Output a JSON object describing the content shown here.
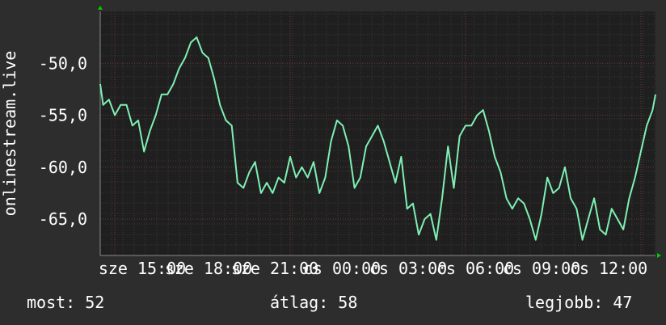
{
  "chart_data": {
    "type": "line",
    "ylabel": "onlinestream.live",
    "ylim": [
      -68.5,
      -45
    ],
    "y_ticks": [
      -65,
      -60,
      -55,
      -50
    ],
    "y_tick_labels": [
      "-65,0",
      "-60,0",
      "-55,0",
      "-50,0"
    ],
    "xlim": [
      14.75,
      24.25
    ],
    "x_ticks": [
      15,
      18,
      21,
      24,
      27,
      30,
      33,
      36
    ],
    "x_tick_labels": [
      "sze 15:00",
      "sze 18:00",
      "sze 21:00",
      "cs 00:00",
      "cs 03:00",
      "cs 06:00",
      "cs 09:00",
      "cs 12:00"
    ],
    "grid": true,
    "colors": {
      "line": "#7ff0b4",
      "background": "#1f1f1f",
      "grid": "#6e3838",
      "axis_arrow": "#00cc00"
    },
    "series": [
      {
        "values": [
          [
            14.75,
            -52.0
          ],
          [
            14.8,
            -54.0
          ],
          [
            14.9,
            -53.5
          ],
          [
            15.0,
            -55.0
          ],
          [
            15.1,
            -54.0
          ],
          [
            15.2,
            -54.0
          ],
          [
            15.3,
            -56.0
          ],
          [
            15.4,
            -55.5
          ],
          [
            15.5,
            -58.5
          ],
          [
            15.6,
            -56.5
          ],
          [
            15.7,
            -55.0
          ],
          [
            15.8,
            -53.0
          ],
          [
            15.9,
            -53.0
          ],
          [
            16.0,
            -52.0
          ],
          [
            16.1,
            -50.5
          ],
          [
            16.2,
            -49.5
          ],
          [
            16.3,
            -48.0
          ],
          [
            16.4,
            -47.5
          ],
          [
            16.5,
            -49.0
          ],
          [
            16.6,
            -49.5
          ],
          [
            16.7,
            -51.5
          ],
          [
            16.8,
            -54.0
          ],
          [
            16.9,
            -55.5
          ],
          [
            17.0,
            -56.0
          ],
          [
            17.1,
            -61.5
          ],
          [
            17.2,
            -62.0
          ],
          [
            17.3,
            -60.5
          ],
          [
            17.4,
            -59.5
          ],
          [
            17.5,
            -62.5
          ],
          [
            17.6,
            -61.5
          ],
          [
            17.7,
            -62.5
          ],
          [
            17.8,
            -61.0
          ],
          [
            17.9,
            -61.5
          ],
          [
            18.0,
            -59.0
          ],
          [
            18.1,
            -61.0
          ],
          [
            18.2,
            -60.0
          ],
          [
            18.3,
            -61.0
          ],
          [
            18.4,
            -59.5
          ],
          [
            18.5,
            -62.5
          ],
          [
            18.6,
            -61.0
          ],
          [
            18.7,
            -57.5
          ],
          [
            18.8,
            -55.5
          ],
          [
            18.9,
            -56.0
          ],
          [
            19.0,
            -58.0
          ],
          [
            19.1,
            -62.0
          ],
          [
            19.2,
            -61.0
          ],
          [
            19.3,
            -58.0
          ],
          [
            19.4,
            -57.0
          ],
          [
            19.5,
            -56.0
          ],
          [
            19.6,
            -57.5
          ],
          [
            19.7,
            -59.5
          ],
          [
            19.8,
            -61.5
          ],
          [
            19.9,
            -59.0
          ],
          [
            20.0,
            -64.0
          ],
          [
            20.1,
            -63.5
          ],
          [
            20.2,
            -66.5
          ],
          [
            20.3,
            -65.0
          ],
          [
            20.4,
            -64.5
          ],
          [
            20.5,
            -67.0
          ],
          [
            20.6,
            -63.0
          ],
          [
            20.7,
            -58.0
          ],
          [
            20.8,
            -62.0
          ],
          [
            20.9,
            -57.0
          ],
          [
            21.0,
            -56.0
          ],
          [
            21.1,
            -56.0
          ],
          [
            21.2,
            -55.0
          ],
          [
            21.3,
            -54.5
          ],
          [
            21.4,
            -56.5
          ],
          [
            21.5,
            -59.0
          ],
          [
            21.6,
            -60.5
          ],
          [
            21.7,
            -63.0
          ],
          [
            21.8,
            -64.0
          ],
          [
            21.9,
            -63.0
          ],
          [
            22.0,
            -63.5
          ],
          [
            22.1,
            -65.0
          ],
          [
            22.2,
            -67.0
          ],
          [
            22.3,
            -64.5
          ],
          [
            22.4,
            -61.0
          ],
          [
            22.5,
            -62.5
          ],
          [
            22.6,
            -62.0
          ],
          [
            22.7,
            -60.0
          ],
          [
            22.8,
            -63.0
          ],
          [
            22.9,
            -64.0
          ],
          [
            23.0,
            -67.0
          ],
          [
            23.1,
            -65.0
          ],
          [
            23.2,
            -63.0
          ],
          [
            23.3,
            -66.0
          ],
          [
            23.4,
            -66.5
          ],
          [
            23.5,
            -64.0
          ],
          [
            23.6,
            -65.0
          ],
          [
            23.7,
            -66.0
          ],
          [
            23.8,
            -63.0
          ],
          [
            23.9,
            -61.0
          ],
          [
            24.0,
            -58.5
          ],
          [
            24.1,
            -56.0
          ],
          [
            24.2,
            -54.5
          ],
          [
            24.25,
            -53.0
          ]
        ]
      }
    ]
  },
  "stats": {
    "current": "most: 52",
    "average": "átlag: 58",
    "best": "legjobb: 47"
  }
}
